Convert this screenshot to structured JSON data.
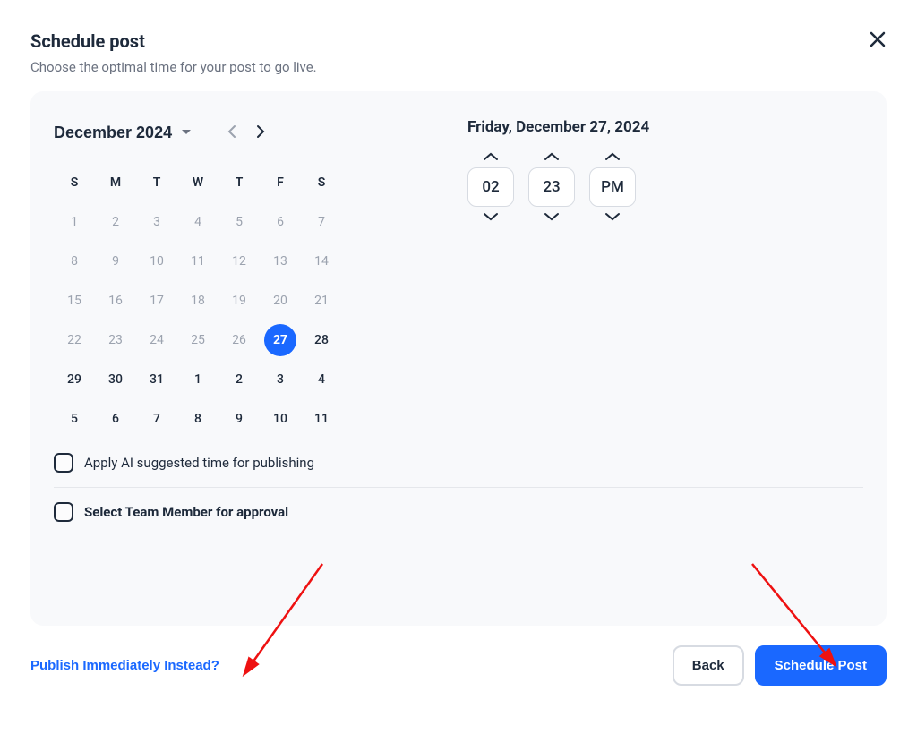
{
  "header": {
    "title": "Schedule post",
    "subtitle": "Choose the optimal time for your post to go live."
  },
  "calendar": {
    "month_label": "December 2024",
    "dow": [
      "S",
      "M",
      "T",
      "W",
      "T",
      "F",
      "S"
    ],
    "weeks": [
      [
        {
          "d": "1",
          "muted": true
        },
        {
          "d": "2",
          "muted": true
        },
        {
          "d": "3",
          "muted": true
        },
        {
          "d": "4",
          "muted": true
        },
        {
          "d": "5",
          "muted": true
        },
        {
          "d": "6",
          "muted": true
        },
        {
          "d": "7",
          "muted": true
        }
      ],
      [
        {
          "d": "8",
          "muted": true
        },
        {
          "d": "9",
          "muted": true
        },
        {
          "d": "10",
          "muted": true
        },
        {
          "d": "11",
          "muted": true
        },
        {
          "d": "12",
          "muted": true
        },
        {
          "d": "13",
          "muted": true
        },
        {
          "d": "14",
          "muted": true
        }
      ],
      [
        {
          "d": "15",
          "muted": true
        },
        {
          "d": "16",
          "muted": true
        },
        {
          "d": "17",
          "muted": true
        },
        {
          "d": "18",
          "muted": true
        },
        {
          "d": "19",
          "muted": true
        },
        {
          "d": "20",
          "muted": true
        },
        {
          "d": "21",
          "muted": true
        }
      ],
      [
        {
          "d": "22",
          "muted": true
        },
        {
          "d": "23",
          "muted": true
        },
        {
          "d": "24",
          "muted": true
        },
        {
          "d": "25",
          "muted": true
        },
        {
          "d": "26",
          "muted": true
        },
        {
          "d": "27",
          "selected": true
        },
        {
          "d": "28"
        }
      ],
      [
        {
          "d": "29"
        },
        {
          "d": "30"
        },
        {
          "d": "31"
        },
        {
          "d": "1"
        },
        {
          "d": "2"
        },
        {
          "d": "3"
        },
        {
          "d": "4"
        }
      ],
      [
        {
          "d": "5"
        },
        {
          "d": "6"
        },
        {
          "d": "7"
        },
        {
          "d": "8"
        },
        {
          "d": "9"
        },
        {
          "d": "10"
        },
        {
          "d": "11"
        }
      ]
    ]
  },
  "time": {
    "selected_date": "Friday, December 27, 2024",
    "hour": "02",
    "minute": "23",
    "period": "PM"
  },
  "options": {
    "ai_suggested": "Apply AI suggested time for publishing",
    "team_approval": "Select Team Member for approval"
  },
  "footer": {
    "publish_now": "Publish Immediately Instead?",
    "back": "Back",
    "schedule": "Schedule Post"
  }
}
